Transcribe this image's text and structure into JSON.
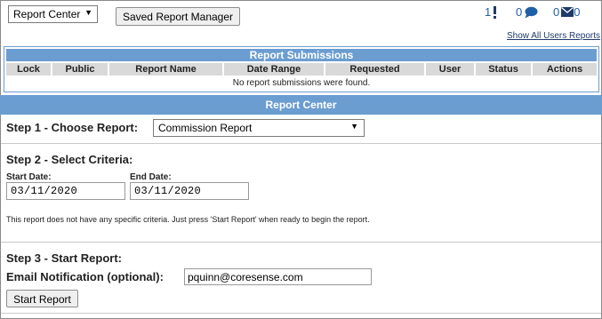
{
  "topbar": {
    "report_center_select": "Report Center",
    "saved_report_manager_button": "Saved Report Manager",
    "alerts_count": "1",
    "messages_count": "0",
    "mail_count": "0",
    "show_all_link": "Show All Users Reports",
    "icons": [
      "alert-icon",
      "chat-bubble-icon",
      "envelope-icon"
    ]
  },
  "submissions": {
    "title": "Report Submissions",
    "columns": [
      "Lock",
      "Public",
      "Report Name",
      "Date Range",
      "Requested",
      "User",
      "Status",
      "Actions"
    ],
    "empty_message": "No report submissions were found."
  },
  "report_center": {
    "title": "Report Center",
    "step1": {
      "label": "Step 1 - Choose Report:",
      "selected_report": "Commission Report"
    },
    "step2": {
      "label": "Step 2 - Select Criteria:",
      "start_date_label": "Start Date:",
      "start_date_value": "03/11/2020",
      "end_date_label": "End Date:",
      "end_date_value": "03/11/2020",
      "note": "This report does not have any specific criteria. Just press 'Start Report' when ready to begin the report."
    },
    "step3": {
      "label": "Step 3 - Start Report:",
      "email_label": "Email Notification (optional):",
      "email_value": "pquinn@coresense.com",
      "start_button": "Start Report"
    }
  },
  "colors": {
    "header_blue": "#6b9dd1",
    "icon_blue": "#1f5fa6",
    "column_header_gray": "#d9d9d9"
  }
}
